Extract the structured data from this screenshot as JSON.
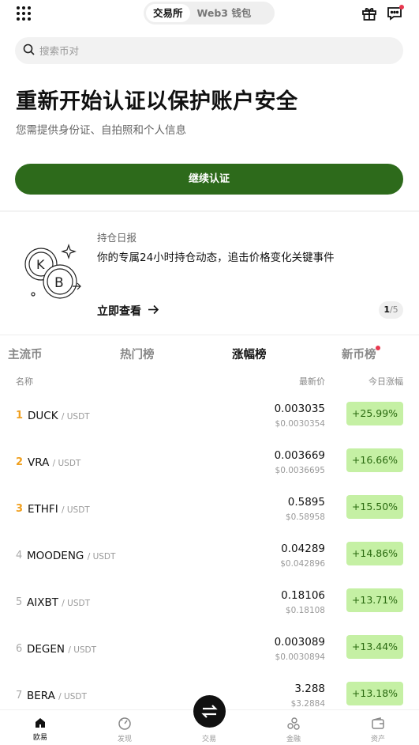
{
  "topbar": {
    "icons": {
      "menu": "grid-menu-icon",
      "gift": "gift-icon",
      "chat": "chat-icon"
    },
    "segments": [
      {
        "label": "交易所",
        "active": true
      },
      {
        "label": "Web3 钱包",
        "active": false
      }
    ]
  },
  "search": {
    "placeholder": "搜索币对",
    "value": ""
  },
  "verify": {
    "title": "重新开始认证以保护账户安全",
    "subtitle": "您需提供身份证、自拍照和个人信息",
    "button": "继续认证"
  },
  "report": {
    "label": "持仓日报",
    "description": "你的专属24小时持仓动态，追击价格变化关键事件",
    "link": "立即查看",
    "pager_current": "1",
    "pager_total": "/5"
  },
  "tabs": [
    {
      "label": "主流币",
      "active": false
    },
    {
      "label": "热门榜",
      "active": false
    },
    {
      "label": "涨幅榜",
      "active": true
    },
    {
      "label": "新币榜",
      "active": false,
      "dot": true
    }
  ],
  "columns": {
    "name": "名称",
    "price": "最新价",
    "change": "今日涨幅"
  },
  "rows": [
    {
      "rank": "1",
      "symbol": "DUCK",
      "quote": "/ USDT",
      "price": "0.003035",
      "fiat": "$0.0030354",
      "change": "+25.99%"
    },
    {
      "rank": "2",
      "symbol": "VRA",
      "quote": "/ USDT",
      "price": "0.003669",
      "fiat": "$0.0036695",
      "change": "+16.66%"
    },
    {
      "rank": "3",
      "symbol": "ETHFI",
      "quote": "/ USDT",
      "price": "0.5895",
      "fiat": "$0.58958",
      "change": "+15.50%"
    },
    {
      "rank": "4",
      "symbol": "MOODENG",
      "quote": "/ USDT",
      "price": "0.04289",
      "fiat": "$0.042896",
      "change": "+14.86%"
    },
    {
      "rank": "5",
      "symbol": "AIXBT",
      "quote": "/ USDT",
      "price": "0.18106",
      "fiat": "$0.18108",
      "change": "+13.71%"
    },
    {
      "rank": "6",
      "symbol": "DEGEN",
      "quote": "/ USDT",
      "price": "0.003089",
      "fiat": "$0.0030894",
      "change": "+13.44%"
    },
    {
      "rank": "7",
      "symbol": "BERA",
      "quote": "/ USDT",
      "price": "3.288",
      "fiat": "$3.2884",
      "change": "+13.18%"
    }
  ],
  "bottomnav": [
    {
      "label": "欧易",
      "icon": "home-icon",
      "active": true
    },
    {
      "label": "发现",
      "icon": "discover-icon",
      "active": false
    },
    {
      "label": "交易",
      "icon": "swap-icon",
      "active": false
    },
    {
      "label": "金融",
      "icon": "finance-icon",
      "active": false
    },
    {
      "label": "资产",
      "icon": "wallet-icon",
      "active": false
    }
  ],
  "colors": {
    "brand_green": "#2d6a1b",
    "gain_bg": "#c5f0a4",
    "gain_text": "#2a6a10",
    "rank_top": "#f0a020",
    "notify_red": "#e8384f"
  }
}
